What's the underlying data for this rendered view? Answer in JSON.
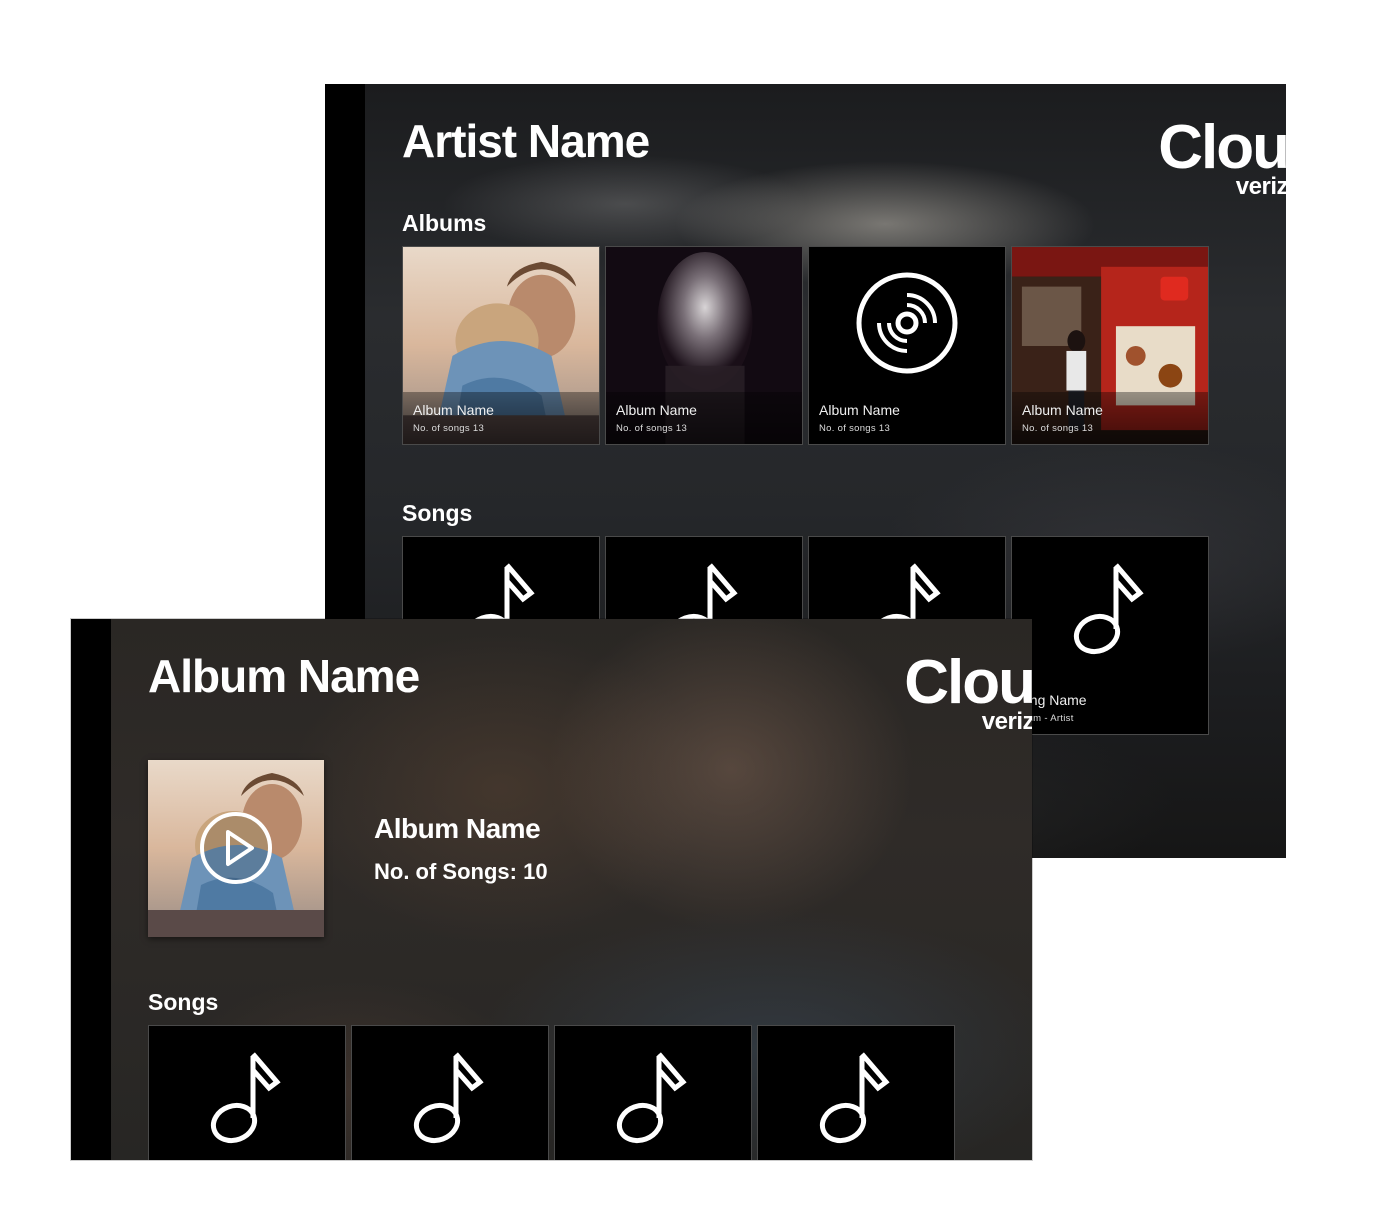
{
  "artist_screen": {
    "title": "Artist Name",
    "brand": {
      "name": "Clou",
      "sub": "veriz"
    },
    "albums_heading": "Albums",
    "albums": [
      {
        "name": "Album Name",
        "songs": "No. of songs 13",
        "art": "couple-photo"
      },
      {
        "name": "Album Name",
        "songs": "No. of songs 13",
        "art": "portrait-photo"
      },
      {
        "name": "Album Name",
        "songs": "No. of songs 13",
        "art": "disc-icon"
      },
      {
        "name": "Album Name",
        "songs": "No. of songs 13",
        "art": "restaurant-photo"
      }
    ],
    "songs_heading": "Songs",
    "song_tiles": [
      {
        "title": "",
        "subtitle": ""
      },
      {
        "title": "",
        "subtitle": ""
      },
      {
        "title": "",
        "subtitle": ""
      },
      {
        "title": "ong Name",
        "subtitle": "bum - Artist"
      }
    ]
  },
  "album_screen": {
    "title": "Album Name",
    "brand": {
      "name": "Clou",
      "sub": "veriz"
    },
    "album_name": "Album Name",
    "song_count": "No. of Songs: 10",
    "songs_heading": "Songs",
    "song_tiles": 4
  },
  "colors": {
    "tile_bg": "#000000",
    "text": "#ffffff",
    "tile_border": "#4a4a4a"
  }
}
